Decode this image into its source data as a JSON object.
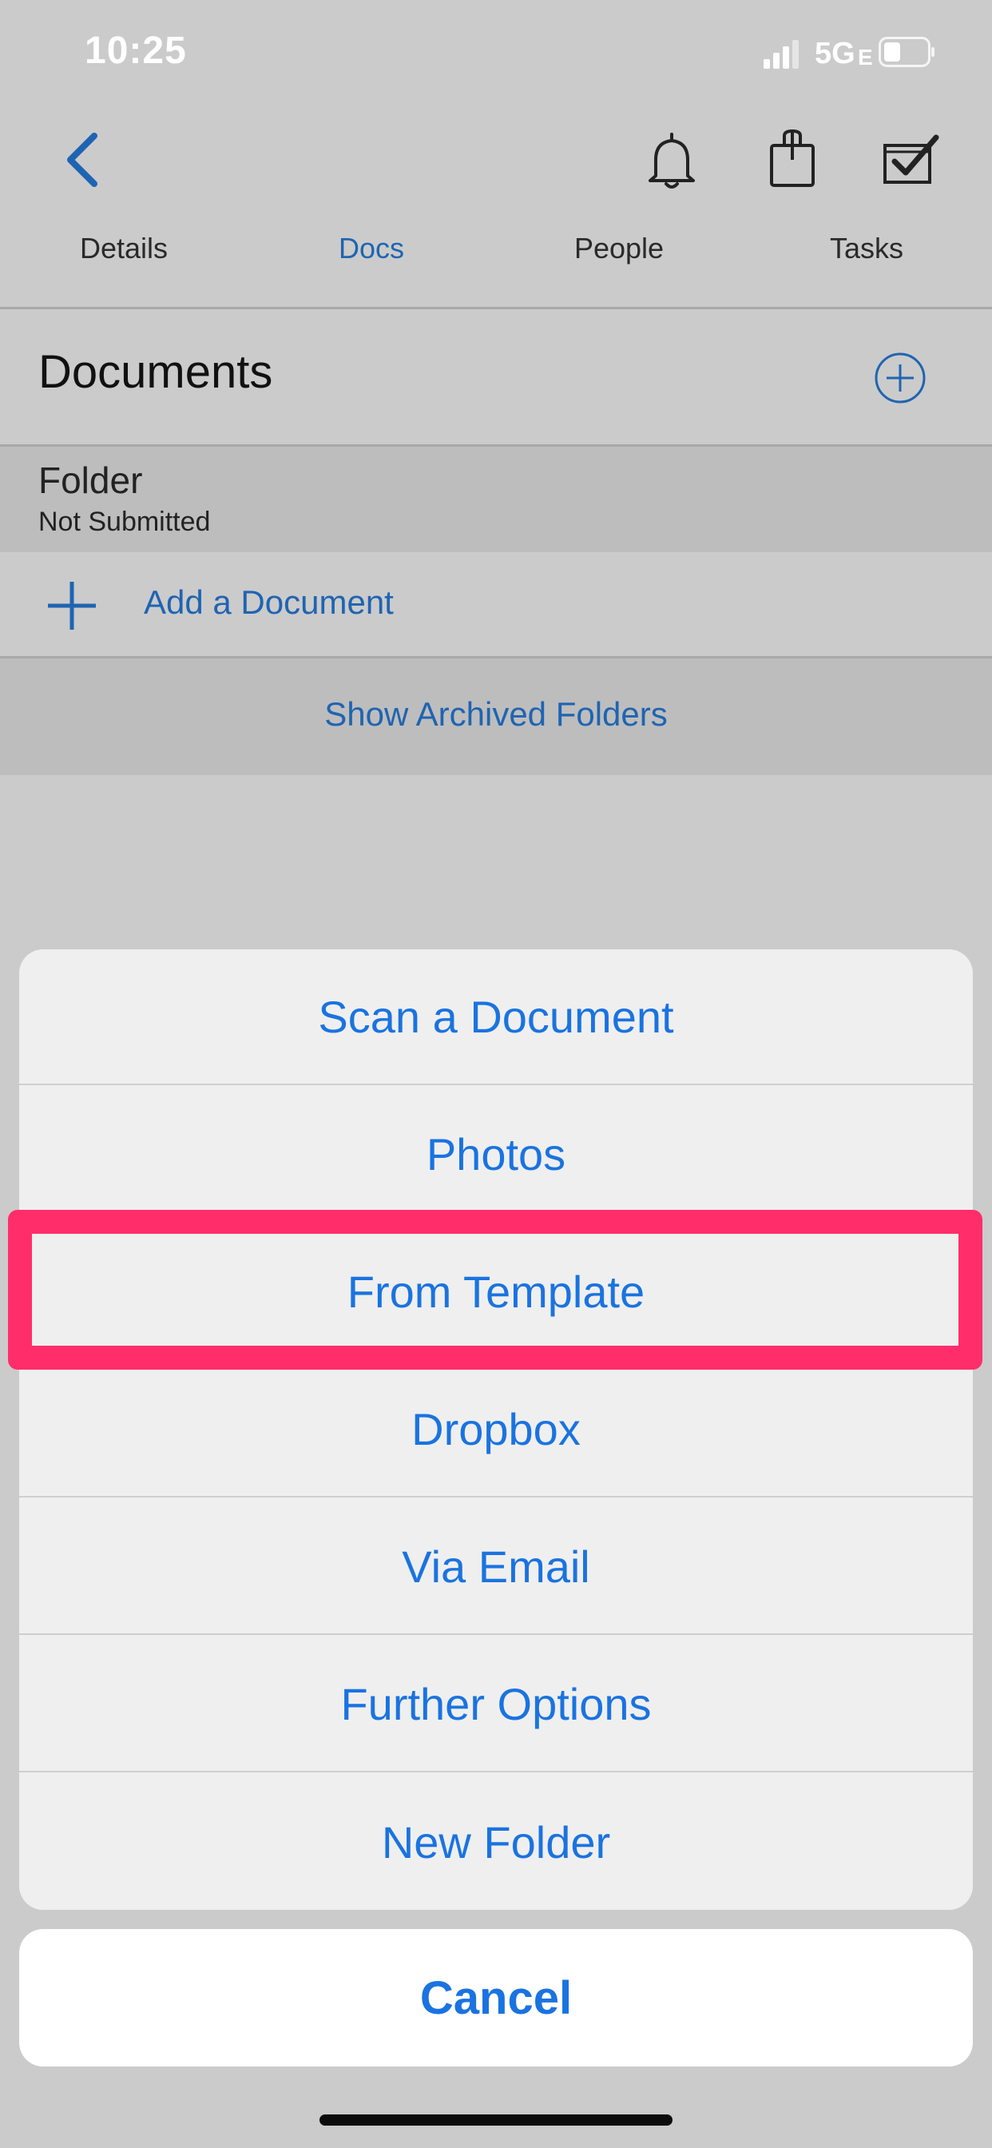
{
  "status_bar": {
    "time": "10:25",
    "network": "5G",
    "network_suffix": "E"
  },
  "header": {
    "icons": [
      "chevron-left-icon",
      "bell-icon",
      "bag-icon",
      "checkbox-tray-icon"
    ],
    "tabs": [
      {
        "label": "Details",
        "active": false
      },
      {
        "label": "Docs",
        "active": true
      },
      {
        "label": "People",
        "active": false
      },
      {
        "label": "Tasks",
        "active": false
      }
    ]
  },
  "documents": {
    "title": "Documents",
    "folder": {
      "name": "Folder",
      "status": "Not Submitted"
    },
    "add_document_label": "Add a Document",
    "show_archived_label": "Show Archived Folders"
  },
  "action_sheet": {
    "items": [
      "Scan a Document",
      "Photos",
      "From Template",
      "Dropbox",
      "Via Email",
      "Further Options",
      "New Folder"
    ],
    "highlighted_item": "From Template",
    "cancel_label": "Cancel"
  },
  "colors": {
    "accent_blue": "#1f64b2",
    "sheet_blue": "#1a73e0",
    "highlight": "#ff2e6a",
    "dim_background": "#cbcbcb"
  }
}
